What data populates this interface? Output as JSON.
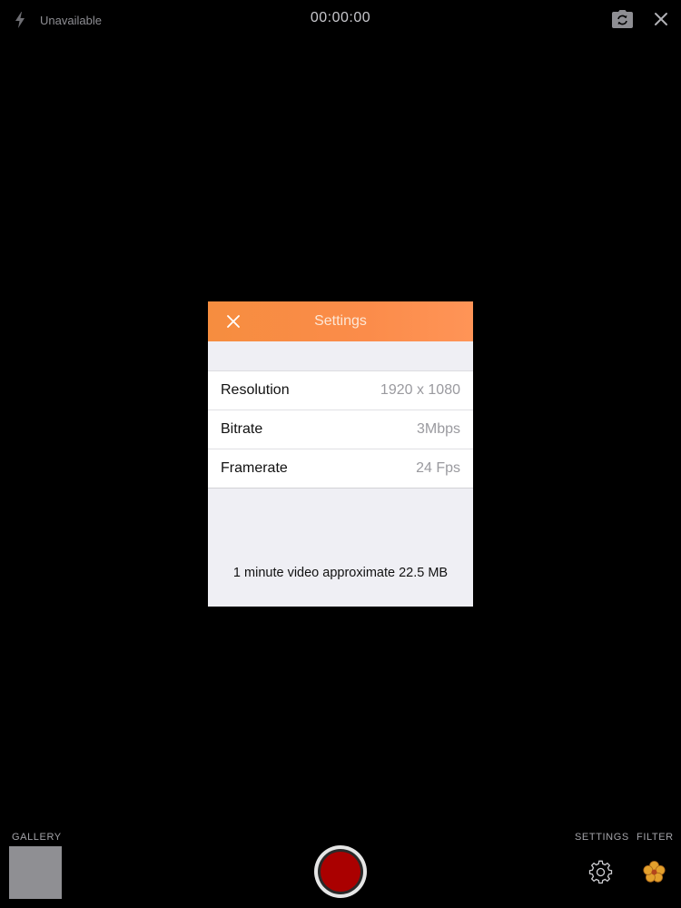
{
  "top_bar": {
    "flash_status": "Unavailable",
    "timer": "00:00:00",
    "icons": [
      "flash-off-icon",
      "flip-camera-icon",
      "close-icon"
    ]
  },
  "settings_dialog": {
    "title": "Settings",
    "header_color": "#fb8c4a",
    "rows": [
      {
        "label": "Resolution",
        "value": "1920 x 1080"
      },
      {
        "label": "Bitrate",
        "value": "3Mbps"
      },
      {
        "label": "Framerate",
        "value": "24 Fps"
      }
    ],
    "footer": "1 minute video approximate 22.5 MB"
  },
  "bottom_bar": {
    "gallery_label": "GALLERY",
    "settings_label": "SETTINGS",
    "filter_label": "FILTER",
    "record_color": "#aa0000",
    "icons": [
      "gear-icon",
      "flower-icon"
    ]
  }
}
